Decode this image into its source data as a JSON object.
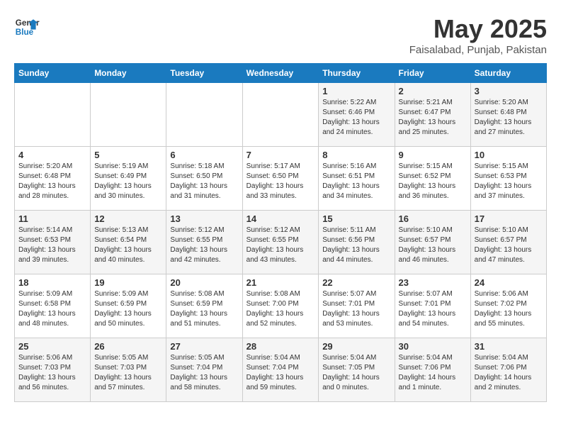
{
  "header": {
    "logo_line1": "General",
    "logo_line2": "Blue",
    "title": "May 2025",
    "subtitle": "Faisalabad, Punjab, Pakistan"
  },
  "weekdays": [
    "Sunday",
    "Monday",
    "Tuesday",
    "Wednesday",
    "Thursday",
    "Friday",
    "Saturday"
  ],
  "weeks": [
    [
      {
        "day": "",
        "info": ""
      },
      {
        "day": "",
        "info": ""
      },
      {
        "day": "",
        "info": ""
      },
      {
        "day": "",
        "info": ""
      },
      {
        "day": "1",
        "info": "Sunrise: 5:22 AM\nSunset: 6:46 PM\nDaylight: 13 hours\nand 24 minutes."
      },
      {
        "day": "2",
        "info": "Sunrise: 5:21 AM\nSunset: 6:47 PM\nDaylight: 13 hours\nand 25 minutes."
      },
      {
        "day": "3",
        "info": "Sunrise: 5:20 AM\nSunset: 6:48 PM\nDaylight: 13 hours\nand 27 minutes."
      }
    ],
    [
      {
        "day": "4",
        "info": "Sunrise: 5:20 AM\nSunset: 6:48 PM\nDaylight: 13 hours\nand 28 minutes."
      },
      {
        "day": "5",
        "info": "Sunrise: 5:19 AM\nSunset: 6:49 PM\nDaylight: 13 hours\nand 30 minutes."
      },
      {
        "day": "6",
        "info": "Sunrise: 5:18 AM\nSunset: 6:50 PM\nDaylight: 13 hours\nand 31 minutes."
      },
      {
        "day": "7",
        "info": "Sunrise: 5:17 AM\nSunset: 6:50 PM\nDaylight: 13 hours\nand 33 minutes."
      },
      {
        "day": "8",
        "info": "Sunrise: 5:16 AM\nSunset: 6:51 PM\nDaylight: 13 hours\nand 34 minutes."
      },
      {
        "day": "9",
        "info": "Sunrise: 5:15 AM\nSunset: 6:52 PM\nDaylight: 13 hours\nand 36 minutes."
      },
      {
        "day": "10",
        "info": "Sunrise: 5:15 AM\nSunset: 6:53 PM\nDaylight: 13 hours\nand 37 minutes."
      }
    ],
    [
      {
        "day": "11",
        "info": "Sunrise: 5:14 AM\nSunset: 6:53 PM\nDaylight: 13 hours\nand 39 minutes."
      },
      {
        "day": "12",
        "info": "Sunrise: 5:13 AM\nSunset: 6:54 PM\nDaylight: 13 hours\nand 40 minutes."
      },
      {
        "day": "13",
        "info": "Sunrise: 5:12 AM\nSunset: 6:55 PM\nDaylight: 13 hours\nand 42 minutes."
      },
      {
        "day": "14",
        "info": "Sunrise: 5:12 AM\nSunset: 6:55 PM\nDaylight: 13 hours\nand 43 minutes."
      },
      {
        "day": "15",
        "info": "Sunrise: 5:11 AM\nSunset: 6:56 PM\nDaylight: 13 hours\nand 44 minutes."
      },
      {
        "day": "16",
        "info": "Sunrise: 5:10 AM\nSunset: 6:57 PM\nDaylight: 13 hours\nand 46 minutes."
      },
      {
        "day": "17",
        "info": "Sunrise: 5:10 AM\nSunset: 6:57 PM\nDaylight: 13 hours\nand 47 minutes."
      }
    ],
    [
      {
        "day": "18",
        "info": "Sunrise: 5:09 AM\nSunset: 6:58 PM\nDaylight: 13 hours\nand 48 minutes."
      },
      {
        "day": "19",
        "info": "Sunrise: 5:09 AM\nSunset: 6:59 PM\nDaylight: 13 hours\nand 50 minutes."
      },
      {
        "day": "20",
        "info": "Sunrise: 5:08 AM\nSunset: 6:59 PM\nDaylight: 13 hours\nand 51 minutes."
      },
      {
        "day": "21",
        "info": "Sunrise: 5:08 AM\nSunset: 7:00 PM\nDaylight: 13 hours\nand 52 minutes."
      },
      {
        "day": "22",
        "info": "Sunrise: 5:07 AM\nSunset: 7:01 PM\nDaylight: 13 hours\nand 53 minutes."
      },
      {
        "day": "23",
        "info": "Sunrise: 5:07 AM\nSunset: 7:01 PM\nDaylight: 13 hours\nand 54 minutes."
      },
      {
        "day": "24",
        "info": "Sunrise: 5:06 AM\nSunset: 7:02 PM\nDaylight: 13 hours\nand 55 minutes."
      }
    ],
    [
      {
        "day": "25",
        "info": "Sunrise: 5:06 AM\nSunset: 7:03 PM\nDaylight: 13 hours\nand 56 minutes."
      },
      {
        "day": "26",
        "info": "Sunrise: 5:05 AM\nSunset: 7:03 PM\nDaylight: 13 hours\nand 57 minutes."
      },
      {
        "day": "27",
        "info": "Sunrise: 5:05 AM\nSunset: 7:04 PM\nDaylight: 13 hours\nand 58 minutes."
      },
      {
        "day": "28",
        "info": "Sunrise: 5:04 AM\nSunset: 7:04 PM\nDaylight: 13 hours\nand 59 minutes."
      },
      {
        "day": "29",
        "info": "Sunrise: 5:04 AM\nSunset: 7:05 PM\nDaylight: 14 hours\nand 0 minutes."
      },
      {
        "day": "30",
        "info": "Sunrise: 5:04 AM\nSunset: 7:06 PM\nDaylight: 14 hours\nand 1 minute."
      },
      {
        "day": "31",
        "info": "Sunrise: 5:04 AM\nSunset: 7:06 PM\nDaylight: 14 hours\nand 2 minutes."
      }
    ]
  ]
}
